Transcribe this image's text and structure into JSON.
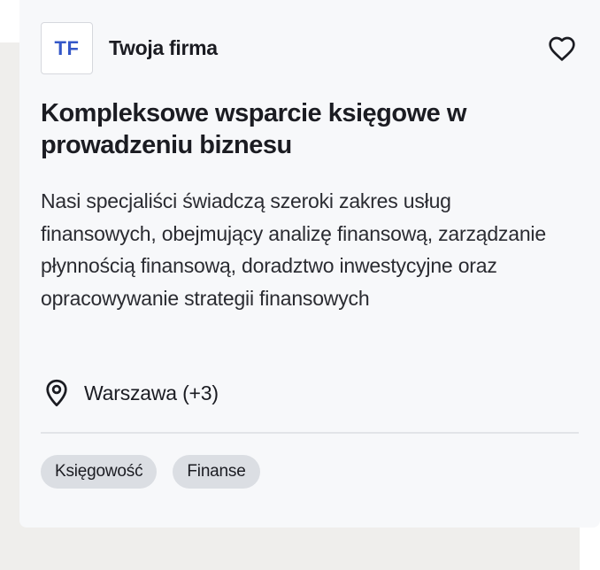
{
  "company": {
    "logo_initials": "TF",
    "name": "Twoja firma"
  },
  "listing": {
    "title": "Kompleksowe wsparcie księgowe w prowadzeniu biznesu",
    "description": "Nasi specjaliści świadczą szeroki zakres usług finansowych, obejmujący analizę finansową, zarządzanie płynnością finansową, doradztwo inwestycyjne oraz opracowywanie strategii finansowych",
    "location": "Warszawa (+3)",
    "tags": [
      "Księgowość",
      "Finanse"
    ]
  },
  "icons": {
    "favorite": "heart-outline-icon",
    "location": "map-pin-icon"
  },
  "colors": {
    "logo_text": "#3457c8",
    "card_bg": "#f7f8fa",
    "tag_bg": "#dbdee3"
  }
}
